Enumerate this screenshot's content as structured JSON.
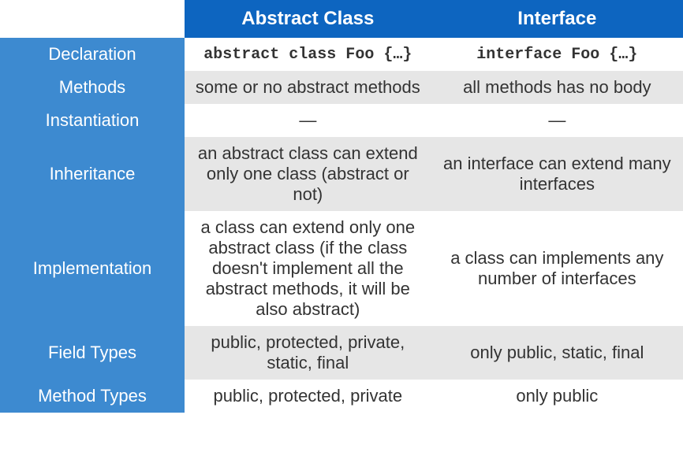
{
  "header": {
    "blank": "",
    "col1": "Abstract Class",
    "col2": "Interface"
  },
  "rows": [
    {
      "label": "Declaration",
      "col1": "abstract class Foo {…}",
      "col2": "interface Foo {…}",
      "code": true,
      "alt": false
    },
    {
      "label": "Methods",
      "col1": "some or no abstract methods",
      "col2": "all methods has no body",
      "code": false,
      "alt": true
    },
    {
      "label": "Instantiation",
      "col1": "—",
      "col2": "—",
      "code": false,
      "alt": false
    },
    {
      "label": "Inheritance",
      "col1": "an abstract class can extend only one class\n(abstract or not)",
      "col2": "an interface can extend many interfaces",
      "code": false,
      "alt": true
    },
    {
      "label": "Implementation",
      "col1": "a class can extend only one abstract class (if the class doesn't implement all the abstract methods, it will be also abstract)",
      "col2": "a class can implements any number of interfaces",
      "code": false,
      "alt": false
    },
    {
      "label": "Field Types",
      "col1": "public, protected, private, static, final",
      "col2": "only public, static, final",
      "code": false,
      "alt": true
    },
    {
      "label": "Method Types",
      "col1": "public, protected, private",
      "col2": "only public",
      "code": false,
      "alt": false
    }
  ]
}
